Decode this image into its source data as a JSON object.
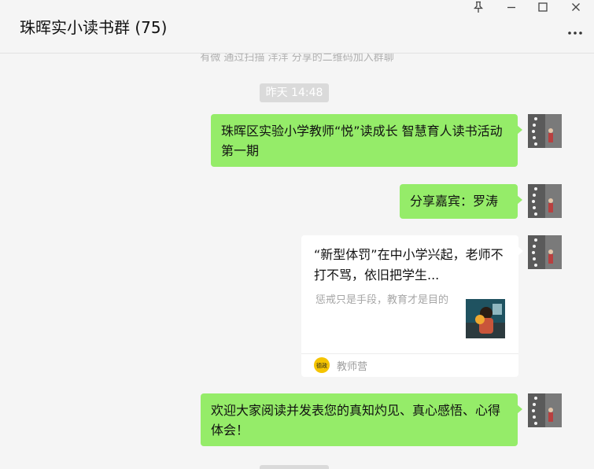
{
  "window": {
    "title": "珠晖实小读书群 (75)",
    "controls": [
      "pin-icon",
      "minimize-icon",
      "maximize-icon",
      "close-icon"
    ],
    "more_icon": "more-dots-icon"
  },
  "chat": {
    "system_message": "有微 通过扫描 洋洋 分享的二维码加入群聊",
    "time_label": "昨天 14:48",
    "messages": [
      {
        "type": "text",
        "text": "珠晖区实验小学教师“悦”读成长 智慧育人读书活动第一期"
      },
      {
        "type": "text",
        "text": "分享嘉宾：罗涛"
      },
      {
        "type": "card",
        "title": "“新型体罚”在中小学兴起，老师不打不骂，依旧把学生...",
        "description": "惩戒只是手段，教育才是目的",
        "source": "教师营",
        "source_logo_text": "德政"
      },
      {
        "type": "text",
        "text": "欢迎大家阅读并发表您的真知灼见、真心感悟、心得体会！"
      }
    ]
  },
  "colors": {
    "background": "#f5f5f5",
    "bubble_self": "#95ec69",
    "time_chip": "#dadada",
    "card": "#ffffff"
  }
}
